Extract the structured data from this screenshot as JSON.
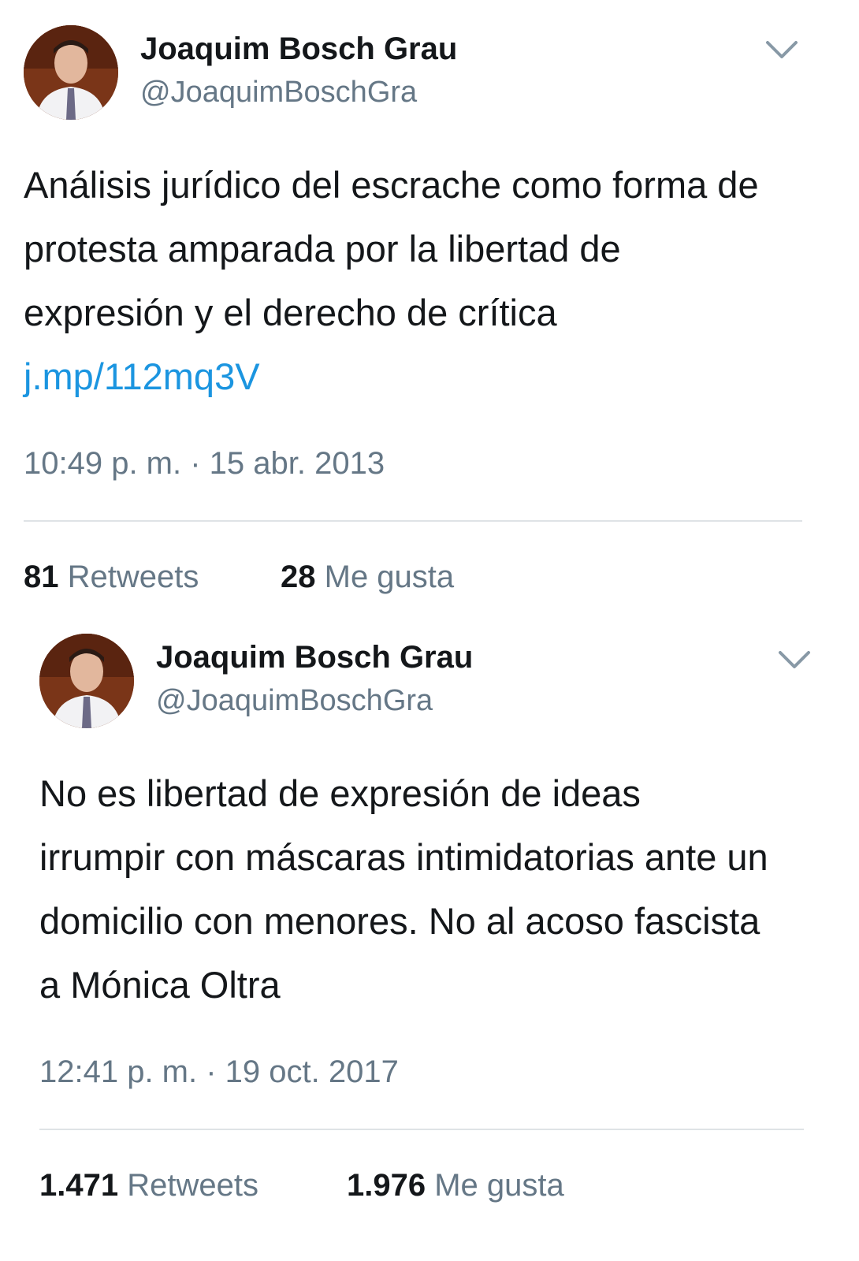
{
  "tweets": [
    {
      "author_name": "Joaquim Bosch Grau",
      "author_handle": "@JoaquimBoschGra",
      "text_before_link": "Análisis jurídico del escrache como forma de protesta amparada por la libertad de expresión y el derecho de crítica ",
      "link": "j.mp/112mq3V",
      "timestamp": "10:49 p. m. · 15 abr. 2013",
      "retweets_count": "81",
      "retweets_label": "Retweets",
      "likes_count": "28",
      "likes_label": "Me gusta"
    },
    {
      "author_name": "Joaquim Bosch Grau",
      "author_handle": "@JoaquimBoschGra",
      "text": "No es libertad de expresión de ideas irrumpir con máscaras intimidatorias ante un domicilio con menores. No al acoso fascista a Mónica Oltra",
      "timestamp": "12:41 p. m. · 19 oct. 2017",
      "retweets_count": "1.471",
      "retweets_label": "Retweets",
      "likes_count": "1.976",
      "likes_label": "Me gusta"
    }
  ],
  "icons": {
    "caret": "chevron-down-icon",
    "avatar": "avatar"
  },
  "colors": {
    "link": "#1b95e0",
    "secondary": "#657786",
    "divider": "#dfe3e6"
  }
}
